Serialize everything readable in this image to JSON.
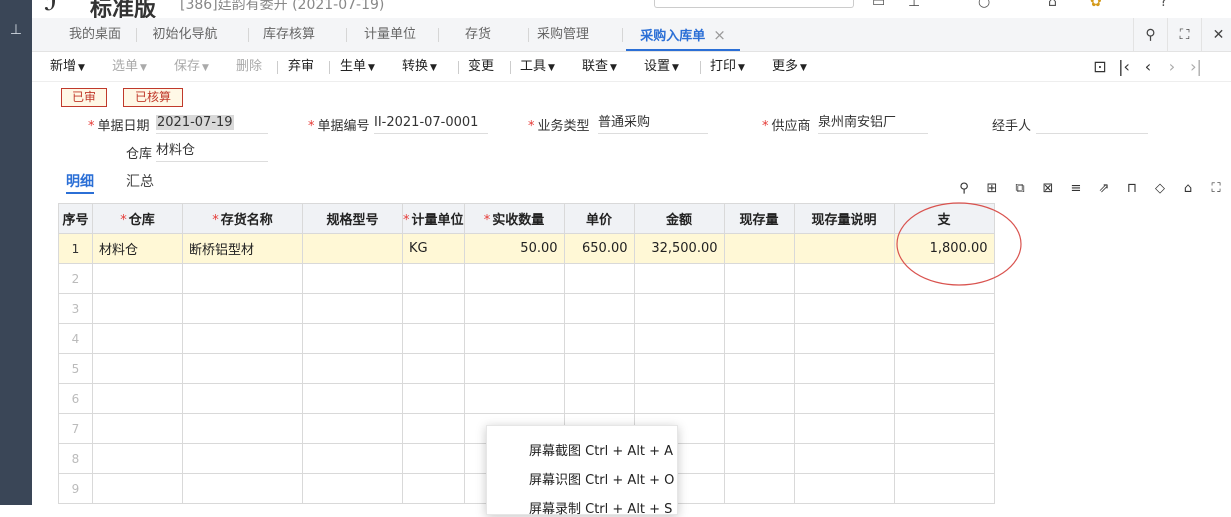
{
  "rail": {
    "glyph": "⊥"
  },
  "titlebar": {
    "logo": "ℐ",
    "product": "标准版",
    "account": "[386]廷韵有委开 (2021-07-19)"
  },
  "tabs": [
    {
      "label": "我的桌面"
    },
    {
      "label": "初始化导航"
    },
    {
      "label": "库存核算"
    },
    {
      "label": "计量单位"
    },
    {
      "label": "存货"
    },
    {
      "label": "采购管理"
    },
    {
      "label": "采购入库单",
      "active": true
    }
  ],
  "toolbar": {
    "items": [
      {
        "label": "新增",
        "caret": true
      },
      {
        "label": "选单",
        "caret": true,
        "disabled": true
      },
      {
        "label": "保存",
        "caret": true,
        "disabled": true
      },
      {
        "label": "删除",
        "disabled": true
      },
      {
        "label": "弃审"
      },
      {
        "label": "生单",
        "caret": true
      },
      {
        "label": "转换",
        "caret": true
      },
      {
        "label": "变更"
      },
      {
        "label": "工具",
        "caret": true
      },
      {
        "label": "联查",
        "caret": true
      },
      {
        "label": "设置",
        "caret": true
      },
      {
        "label": "打印",
        "caret": true
      },
      {
        "label": "更多",
        "caret": true
      }
    ]
  },
  "stamps": {
    "audited": "已审",
    "costed": "已核算"
  },
  "header": {
    "date_label": "单据日期",
    "date_value": "2021-07-19",
    "docno_label": "单据编号",
    "docno_value": "II-2021-07-0001",
    "biztype_label": "业务类型",
    "biztype_value": "普通采购",
    "supplier_label": "供应商",
    "supplier_value": "泉州南安铝厂",
    "handler_label": "经手人",
    "handler_value": "",
    "warehouse_label": "仓库",
    "warehouse_value": "材料仓"
  },
  "subtabs": {
    "detail": "明细",
    "summary": "汇总"
  },
  "grid": {
    "columns": [
      {
        "label": "序号",
        "required": false
      },
      {
        "label": "仓库",
        "required": true
      },
      {
        "label": "存货名称",
        "required": true
      },
      {
        "label": "规格型号",
        "required": false
      },
      {
        "label": "计量单位",
        "required": true
      },
      {
        "label": "实收数量",
        "required": true
      },
      {
        "label": "单价",
        "required": false
      },
      {
        "label": "金额",
        "required": false
      },
      {
        "label": "现存量",
        "required": false
      },
      {
        "label": "现存量说明",
        "required": false
      },
      {
        "label": "支",
        "required": false
      }
    ],
    "rows": [
      {
        "idx": "1",
        "warehouse": "材料仓",
        "item": "断桥铝型材",
        "spec": "",
        "unit": "KG",
        "qty": "50.00",
        "price": "650.00",
        "amount": "32,500.00",
        "stock": "",
        "stock_note": "",
        "zhi": "1,800.00"
      },
      {
        "idx": "2"
      },
      {
        "idx": "3"
      },
      {
        "idx": "4"
      },
      {
        "idx": "5"
      },
      {
        "idx": "6"
      },
      {
        "idx": "7"
      },
      {
        "idx": "8"
      },
      {
        "idx": "9"
      }
    ]
  },
  "context_menu": {
    "items": [
      {
        "label": "屏幕截图 Ctrl + Alt + A"
      },
      {
        "label": "屏幕识图 Ctrl + Alt + O"
      },
      {
        "label": "屏幕录制 Ctrl + Alt + S"
      }
    ]
  },
  "colors": {
    "accent": "#2b6fd6",
    "required": "#e53935",
    "stamp": "#c0392b",
    "active_row": "#fff8d6",
    "annotation": "#d9534f"
  }
}
